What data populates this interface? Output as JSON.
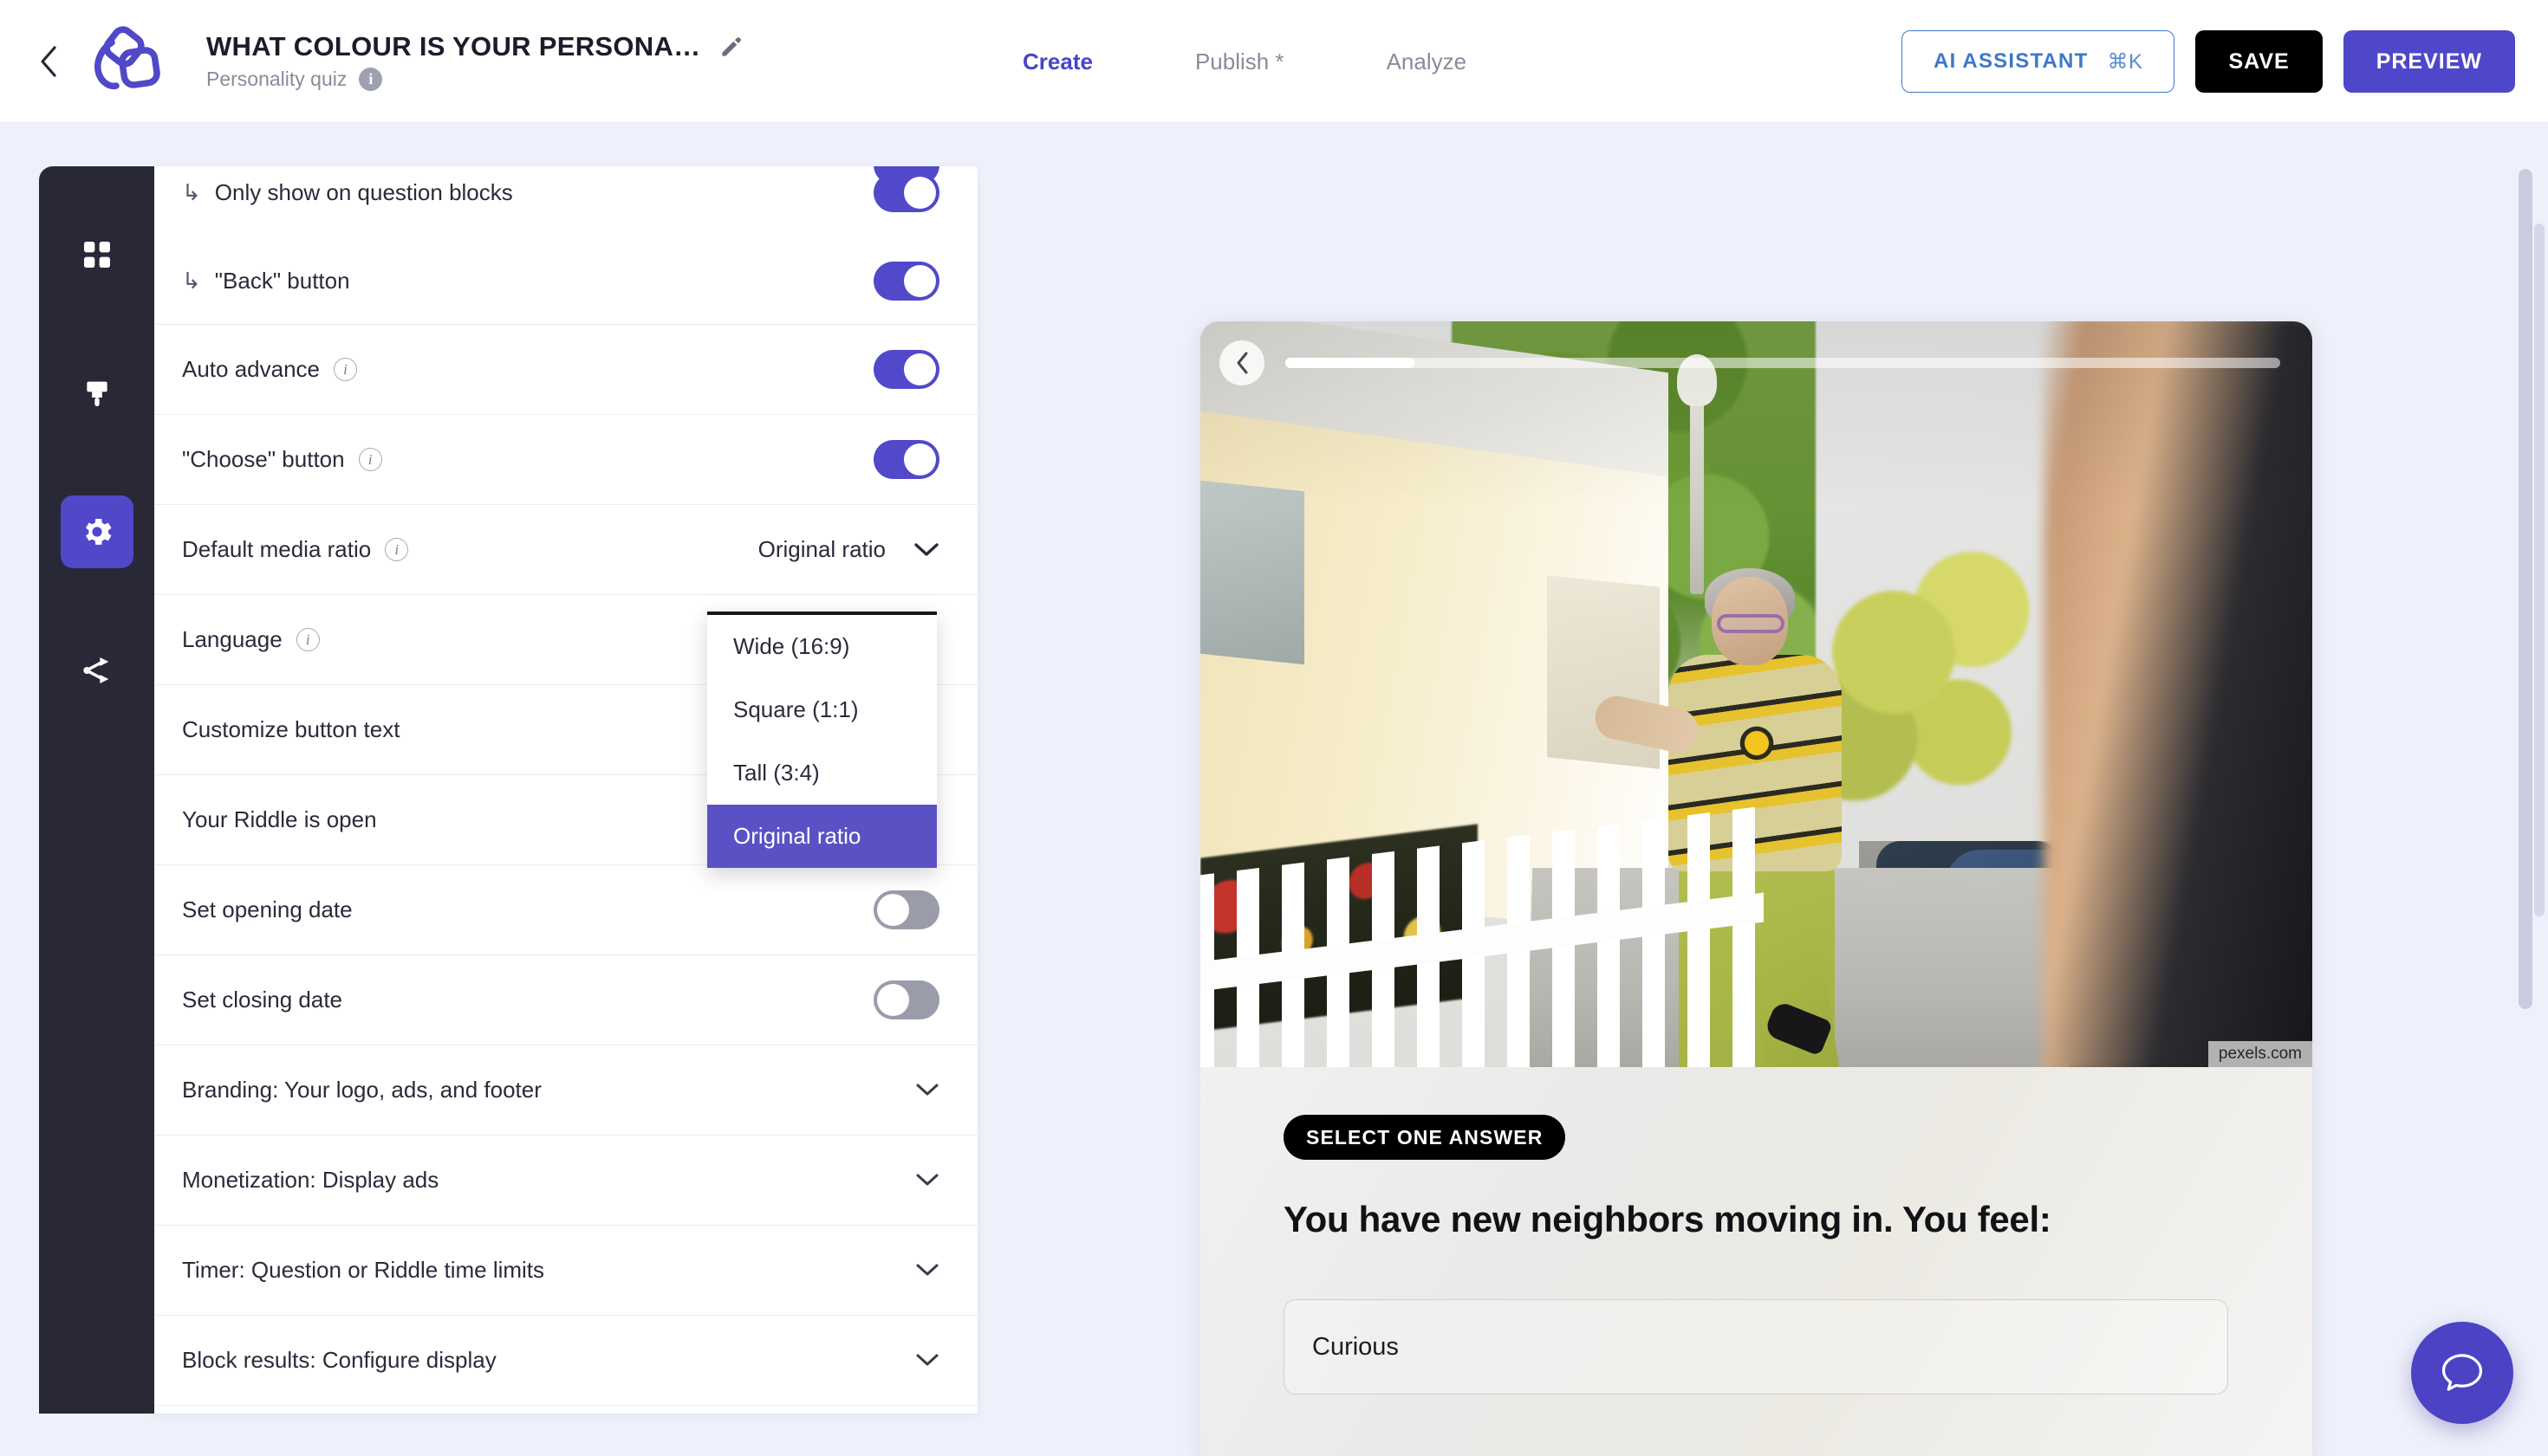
{
  "header": {
    "back_icon": "chevron-left-icon",
    "logo_icon": "riddle-logo-icon",
    "quiz_title": "WHAT COLOUR IS YOUR PERSONA…",
    "edit_icon": "pencil-icon",
    "quiz_type": "Personality quiz",
    "info_icon": "info-icon",
    "nav": [
      {
        "label": "Create",
        "active": true
      },
      {
        "label": "Publish *",
        "active": false
      },
      {
        "label": "Analyze",
        "active": false
      }
    ],
    "ai_assistant_label": "AI ASSISTANT",
    "ai_assistant_shortcut": "⌘K",
    "save_label": "SAVE",
    "preview_label": "PREVIEW"
  },
  "sidebar": {
    "items": [
      {
        "icon": "grid-blocks-icon",
        "active": false
      },
      {
        "icon": "paintbrush-icon",
        "active": false
      },
      {
        "icon": "gear-icon",
        "active": true
      },
      {
        "icon": "share-branch-icon",
        "active": false
      }
    ]
  },
  "settings": {
    "rows": [
      {
        "label": "Only show on question blocks",
        "nested": true,
        "control": "toggle",
        "value": "on"
      },
      {
        "label": "\"Back\" button",
        "nested": true,
        "control": "toggle",
        "value": "on"
      },
      {
        "label": "Auto advance",
        "nested": false,
        "control": "toggle",
        "value": "on",
        "info": true
      },
      {
        "label": "\"Choose\" button",
        "nested": false,
        "control": "toggle",
        "value": "on",
        "info": true
      },
      {
        "label": "Default media ratio",
        "nested": false,
        "control": "select",
        "value": "Original ratio",
        "info": true
      },
      {
        "label": "Language",
        "nested": false,
        "control": "none",
        "info": true
      },
      {
        "label": "Customize button text",
        "nested": false,
        "control": "none"
      },
      {
        "label": "Your Riddle is open",
        "nested": false,
        "control": "none"
      },
      {
        "label": "Set opening date",
        "nested": false,
        "control": "toggle",
        "value": "off"
      },
      {
        "label": "Set closing date",
        "nested": false,
        "control": "toggle",
        "value": "off"
      },
      {
        "label": "Branding: Your logo, ads, and footer",
        "nested": false,
        "control": "chevron"
      },
      {
        "label": "Monetization: Display ads",
        "nested": false,
        "control": "chevron"
      },
      {
        "label": "Timer: Question or Riddle time limits",
        "nested": false,
        "control": "chevron"
      },
      {
        "label": "Block results: Configure display",
        "nested": false,
        "control": "chevron"
      }
    ]
  },
  "dropdown": {
    "open": true,
    "options": [
      {
        "label": "Wide (16:9)",
        "selected": false
      },
      {
        "label": "Square (1:1)",
        "selected": false
      },
      {
        "label": "Tall (3:4)",
        "selected": false
      },
      {
        "label": "Original ratio",
        "selected": true
      }
    ]
  },
  "preview": {
    "back_icon": "chevron-left-icon",
    "progress_percent": 13,
    "image_credit": "pexels.com",
    "badge": "SELECT ONE ANSWER",
    "question": "You have new neighbors moving in. You feel:",
    "answers": [
      "Curious"
    ]
  },
  "chat": {
    "icon": "chat-bubble-icon"
  },
  "colors": {
    "accent_purple": "#4f47c9",
    "dropdown_highlight": "#5a52c4",
    "toggle_on": "#5149ca",
    "toggle_off": "#9b9ca9",
    "ai_blue": "#3d78c9",
    "rail_dark": "#282836",
    "page_bg": "#eef0fb"
  }
}
